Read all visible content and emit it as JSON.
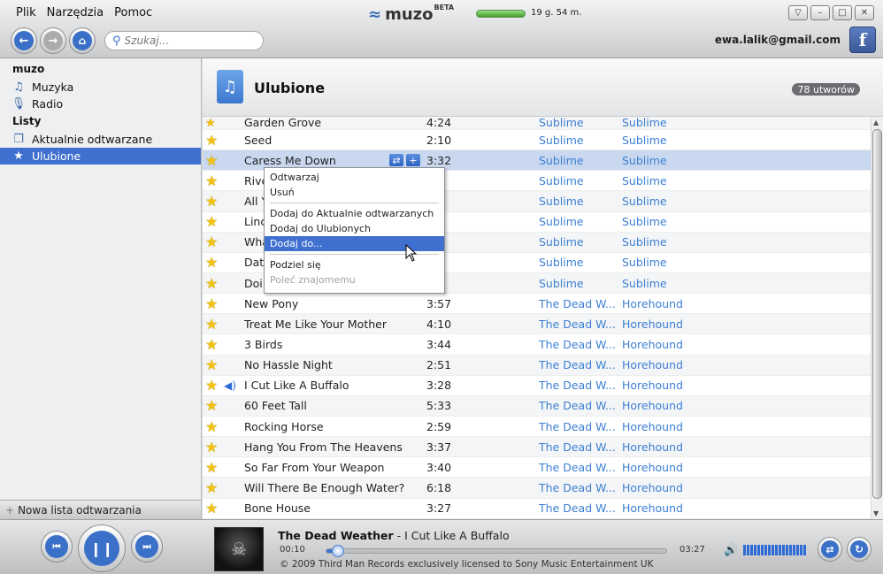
{
  "menu": [
    "Plik",
    "Narzędzia",
    "Pomoc"
  ],
  "logo": {
    "name": "muzo",
    "badge": "BETA"
  },
  "quota_time": "19 g. 54 m.",
  "search": {
    "placeholder": "Szukaj..."
  },
  "user_email": "ewa.lalik@gmail.com",
  "facebook": "f",
  "sidebar": {
    "section_muzo": "muzo",
    "muzyka": "Muzyka",
    "radio": "Radio",
    "section_listy": "Listy",
    "aktualnie": "Aktualnie odtwarzane",
    "ulubione": "Ulubione",
    "new_playlist": "Nowa lista odtwarzania"
  },
  "playlist": {
    "title": "Ulubione",
    "count": "78 utworów"
  },
  "tracks": [
    {
      "title": "Garden Grove",
      "duration": "4:24",
      "artist": "Sublime",
      "album": "Sublime"
    },
    {
      "title": "Seed",
      "duration": "2:10",
      "artist": "Sublime",
      "album": "Sublime"
    },
    {
      "title": "Caress Me Down",
      "duration": "3:32",
      "artist": "Sublime",
      "album": "Sublime"
    },
    {
      "title": "Rive",
      "duration": "6",
      "artist": "Sublime",
      "album": "Sublime"
    },
    {
      "title": "All Y",
      "duration": "5",
      "artist": "Sublime",
      "album": "Sublime"
    },
    {
      "title": "Linc",
      "duration": "2",
      "artist": "Sublime",
      "album": "Sublime"
    },
    {
      "title": "Wha",
      "duration": "0",
      "artist": "Sublime",
      "album": "Sublime"
    },
    {
      "title": "Dat",
      "duration": "5",
      "artist": "Sublime",
      "album": "Sublime"
    },
    {
      "title": "Doi",
      "duration": "3",
      "artist": "Sublime",
      "album": "Sublime"
    },
    {
      "title": "New Pony",
      "duration": "3:57",
      "artist": "The Dead W...",
      "album": "Horehound"
    },
    {
      "title": "Treat Me Like Your Mother",
      "duration": "4:10",
      "artist": "The Dead W...",
      "album": "Horehound"
    },
    {
      "title": "3 Birds",
      "duration": "3:44",
      "artist": "The Dead W...",
      "album": "Horehound"
    },
    {
      "title": "No Hassle Night",
      "duration": "2:51",
      "artist": "The Dead W...",
      "album": "Horehound"
    },
    {
      "title": "I Cut Like A Buffalo",
      "duration": "3:28",
      "artist": "The Dead W...",
      "album": "Horehound"
    },
    {
      "title": "60 Feet Tall",
      "duration": "5:33",
      "artist": "The Dead W...",
      "album": "Horehound"
    },
    {
      "title": "Rocking Horse",
      "duration": "2:59",
      "artist": "The Dead W...",
      "album": "Horehound"
    },
    {
      "title": "Hang You From The Heavens",
      "duration": "3:37",
      "artist": "The Dead W...",
      "album": "Horehound"
    },
    {
      "title": "So Far From Your Weapon",
      "duration": "3:40",
      "artist": "The Dead W...",
      "album": "Horehound"
    },
    {
      "title": "Will There Be Enough Water?",
      "duration": "6:18",
      "artist": "The Dead W...",
      "album": "Horehound"
    },
    {
      "title": "Bone House",
      "duration": "3:27",
      "artist": "The Dead W...",
      "album": "Horehound"
    }
  ],
  "context_menu": {
    "play": "Odtwarzaj",
    "remove": "Usuń",
    "add_current": "Dodaj do Aktualnie odtwarzanych",
    "add_fav": "Dodaj do Ulubionych",
    "add_to": "Dodaj do...",
    "share": "Podziel się",
    "recommend": "Poleć znajomemu"
  },
  "player": {
    "artist": "The Dead Weather",
    "separator": " - ",
    "track": "I Cut Like A Buffalo",
    "elapsed": "00:10",
    "total": "03:27",
    "progress_fraction": 0.05,
    "copyright": "© 2009 Third Man Records exclusively licensed to Sony Music Entertainment UK"
  },
  "colors": {
    "accent": "#3f6fcf",
    "link": "#3b7fd4",
    "star": "#f3c313"
  }
}
